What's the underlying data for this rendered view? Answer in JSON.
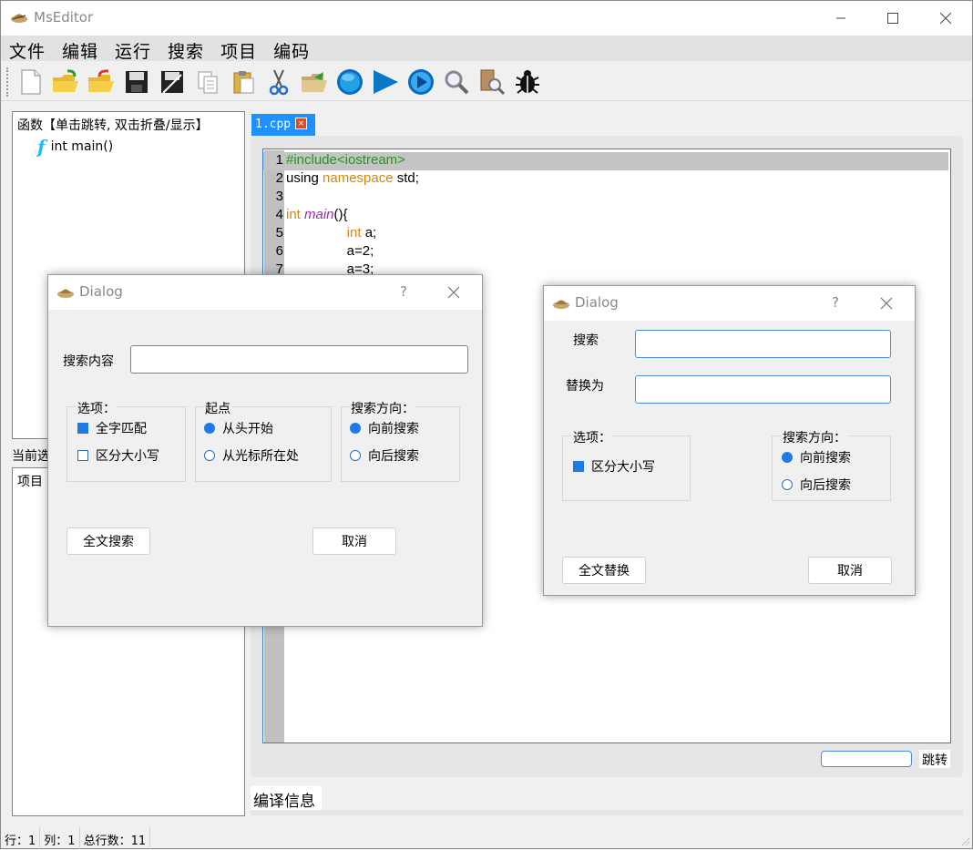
{
  "window": {
    "title": "MsEditor"
  },
  "menu": [
    "文件",
    "编辑",
    "运行",
    "搜索",
    "项目",
    "编码"
  ],
  "toolbar": [
    "new-file-icon",
    "open-file-icon",
    "open-recent-icon",
    "save-icon",
    "save-as-icon",
    "copy-icon",
    "paste-icon",
    "cut-icon",
    "open-project-icon",
    "record-icon",
    "run-icon",
    "compile-run-icon",
    "search-icon",
    "search-replace-icon",
    "debug-icon"
  ],
  "functions_panel": {
    "header": "函数【单击跳转, 双击折叠/显示】",
    "items": [
      {
        "icon": "f",
        "label": "int main()"
      }
    ]
  },
  "project_panel": {
    "label_partial": "当前选",
    "item": "项目"
  },
  "editor": {
    "tab_label": "1.cpp",
    "lines": [
      {
        "n": "1",
        "parts": [
          {
            "t": "#include<iostream>",
            "c": "#1a9a1a"
          }
        ]
      },
      {
        "n": "2",
        "parts": [
          {
            "t": "using ",
            "c": "#000"
          },
          {
            "t": "namespace",
            "c": "#d4880a"
          },
          {
            "t": " std;",
            "c": "#000"
          }
        ]
      },
      {
        "n": "3",
        "parts": []
      },
      {
        "n": "4",
        "parts": [
          {
            "t": "int ",
            "c": "#d4880a"
          },
          {
            "t": "main",
            "c": "#9b2aa8",
            "i": true
          },
          {
            "t": "(){",
            "c": "#000"
          }
        ]
      },
      {
        "n": "5",
        "parts": [
          {
            "t": "                int",
            "c": "#d4880a"
          },
          {
            "t": " a;",
            "c": "#000"
          }
        ]
      },
      {
        "n": "6",
        "parts": [
          {
            "t": "                a=2;",
            "c": "#000"
          }
        ]
      },
      {
        "n": "7",
        "parts": [
          {
            "t": "                a=3;",
            "c": "#000"
          }
        ]
      }
    ]
  },
  "goto": {
    "button": "跳转",
    "value": ""
  },
  "compile_tab": "编译信息",
  "status": {
    "row": "行：1",
    "col": "列：1",
    "total": "总行数：11"
  },
  "find_dialog": {
    "title": "Dialog",
    "help": "?",
    "search_label": "搜索内容",
    "search_value": "",
    "options_title": "选项：",
    "opt_whole_word": "全字匹配",
    "opt_case": "区分大小写",
    "origin_title": "起点",
    "origin_start": "从头开始",
    "origin_cursor": "从光标所在处",
    "direction_title": "搜索方向：",
    "dir_forward": "向前搜索",
    "dir_backward": "向后搜索",
    "search_all_button": "全文搜索",
    "cancel_button": "取消"
  },
  "replace_dialog": {
    "title": "Dialog",
    "help": "?",
    "search_label": "搜索",
    "search_value": "",
    "replace_label": "替换为",
    "replace_value": "",
    "options_title": "选项：",
    "opt_case": "区分大小写",
    "direction_title": "搜索方向：",
    "dir_forward": "向前搜索",
    "dir_backward": "向后搜索",
    "replace_all_button": "全文替换",
    "cancel_button": "取消"
  }
}
